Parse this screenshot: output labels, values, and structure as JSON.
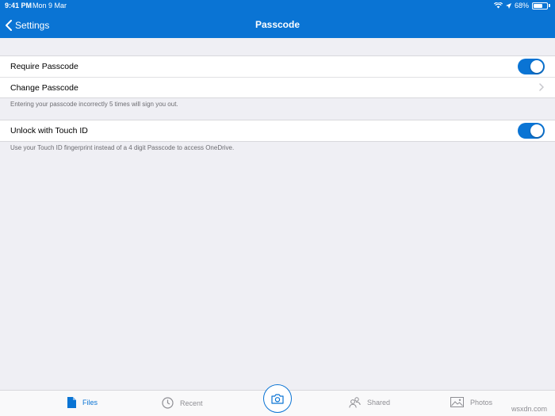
{
  "status_bar": {
    "time": "9:41 PM",
    "date": "Mon 9 Mar",
    "battery": "68%",
    "battery_level": 0.68
  },
  "nav": {
    "back_label": "Settings",
    "title": "Passcode"
  },
  "passcode_section": {
    "require_label": "Require Passcode",
    "require_on": true,
    "change_label": "Change Passcode",
    "footer": "Entering your passcode incorrectly 5 times will sign you out."
  },
  "touchid_section": {
    "unlock_label": "Unlock with Touch ID",
    "unlock_on": true,
    "footer": "Use your Touch ID fingerprint instead of a 4 digit Passcode to access OneDrive."
  },
  "tabbar": {
    "files": "Files",
    "recent": "Recent",
    "shared": "Shared",
    "photos": "Photos",
    "active": "files"
  },
  "watermark": "wsxdn.com",
  "colors": {
    "accent": "#0a74d4",
    "background": "#efeff4"
  }
}
